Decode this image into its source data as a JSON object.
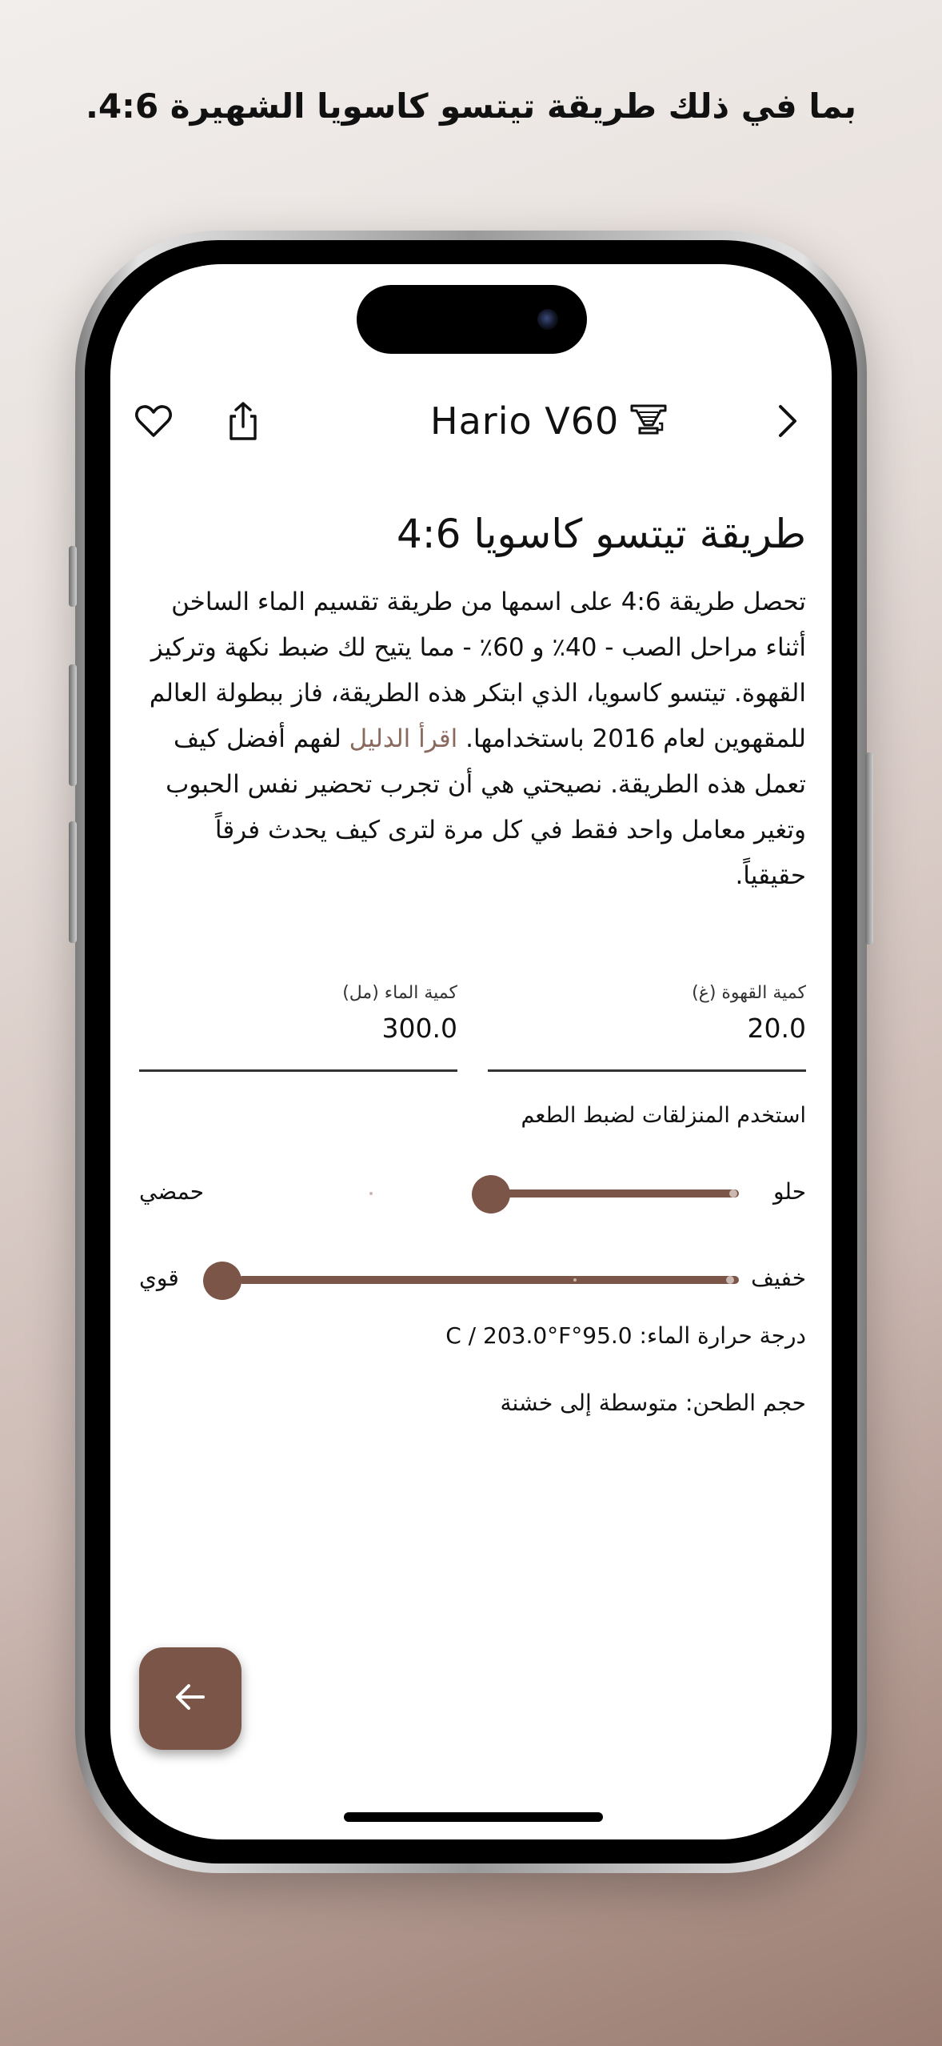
{
  "promo": {
    "headline": "بما في ذلك طريقة تيتسو كاسويا الشهيرة 4:6."
  },
  "header": {
    "title": "Hario V60",
    "icons": {
      "favorite": "heart-icon",
      "share": "share-icon",
      "brewer": "pour-over-icon",
      "next": "chevron-right-icon"
    }
  },
  "method": {
    "title": "طريقة تيتسو كاسويا 4:6",
    "description_main": "تحصل طريقة 4:6 على اسمها من طريقة تقسيم الماء الساخن أثناء مراحل الصب - 40٪ و 60٪ - مما يتيح لك ضبط نكهة وتركيز القهوة. تيتسو كاسويا، الذي ابتكر هذه الطريقة، فاز ببطولة العالم للمقهوين لعام 2016 باستخدامها.",
    "guide_link": "اقرأ الدليل",
    "description_tail": "لفهم أفضل كيف تعمل هذه الطريقة. نصيحتي هي أن تجرب تحضير نفس الحبوب وتغير معامل واحد فقط في كل مرة لترى كيف يحدث فرقاً حقيقياً."
  },
  "inputs": {
    "coffee": {
      "label": "كمية القهوة (غ)",
      "value": "20.0"
    },
    "water": {
      "label": "كمية الماء (مل)",
      "value": "300.0"
    }
  },
  "sliders": {
    "hint": "استخدم المنزلقات لضبط الطعم",
    "taste": {
      "left_label": "حمضي",
      "right_label": "حلو",
      "value_fraction": 1.0
    },
    "strength": {
      "left_label": "قوي",
      "right_label": "خفيف",
      "value_fraction": 1.0
    }
  },
  "info": {
    "temperature": "درجة حرارة الماء: 95.0°C / 203.0°F",
    "grind": "حجم الطحن: متوسطة إلى خشنة"
  },
  "fab": {
    "icon": "arrow-left-icon"
  },
  "colors": {
    "accent": "#7b5648",
    "link": "#8a6a5e"
  }
}
